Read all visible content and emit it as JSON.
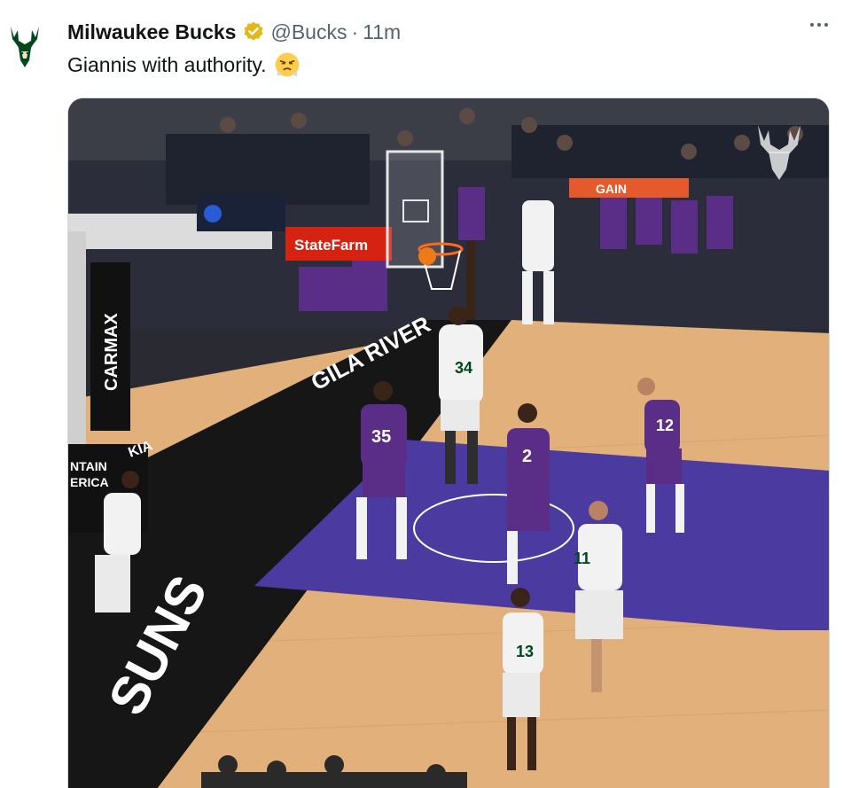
{
  "tweet": {
    "display_name": "Milwaukee Bucks",
    "handle": "@Bucks",
    "separator": "·",
    "time": "11m",
    "text": "Giannis with authority.",
    "emoji_icon": "steam-from-nose-emoji",
    "avatar_icon": "bucks-deer-logo"
  },
  "media": {
    "type": "photo",
    "arena_signs": {
      "statefarm": "StateFarm",
      "carmax": "CARMAX",
      "gila": "GILA RIVER",
      "kia": "KIA",
      "mountain": "NTAIN\nERICA",
      "gain": "GAIN"
    },
    "jerseys": [
      "34",
      "35",
      "2",
      "12",
      "11",
      "13"
    ]
  },
  "colors": {
    "brand_green": "#00471b",
    "verified_gold": "#e2b719",
    "suns_purple": "#5a2d86",
    "court_wood": "#e6b987"
  }
}
